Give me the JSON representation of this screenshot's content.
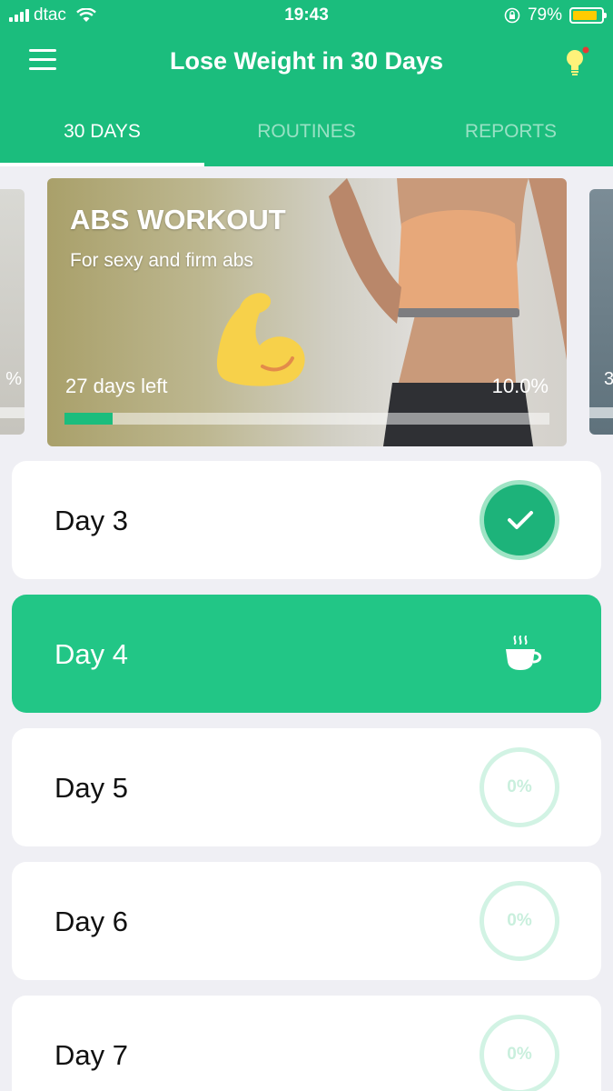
{
  "status_bar": {
    "carrier": "dtac",
    "time": "19:43",
    "battery": "79%",
    "battery_level": 0.79
  },
  "header": {
    "title": "Lose Weight in 30 Days",
    "menu_icon": "hamburger-menu-icon",
    "tip_icon": "lightbulb-icon"
  },
  "tabs": [
    {
      "label": "30 DAYS",
      "active": true
    },
    {
      "label": "ROUTINES",
      "active": false
    },
    {
      "label": "REPORTS",
      "active": false
    }
  ],
  "carousel": {
    "prev_card_pct": "%",
    "next_card_pct": "3",
    "current": {
      "title": "ABS WORKOUT",
      "subtitle": "For sexy and firm abs",
      "days_left": "27 days left",
      "percent": "10.0%",
      "progress": 0.1,
      "icon": "flexed-biceps-icon"
    }
  },
  "days": [
    {
      "label": "Day 3",
      "state": "completed",
      "icon": "checkmark-icon"
    },
    {
      "label": "Day 4",
      "state": "rest",
      "icon": "coffee-cup-icon"
    },
    {
      "label": "Day 5",
      "state": "pending",
      "progress_text": "0%"
    },
    {
      "label": "Day 6",
      "state": "pending",
      "progress_text": "0%"
    },
    {
      "label": "Day 7",
      "state": "pending",
      "progress_text": "0%"
    }
  ],
  "colors": {
    "brand_green": "#1bbd7d",
    "current_day_green": "#22c686",
    "battery_yellow": "#ffcc00",
    "badge_red": "#e53935"
  }
}
